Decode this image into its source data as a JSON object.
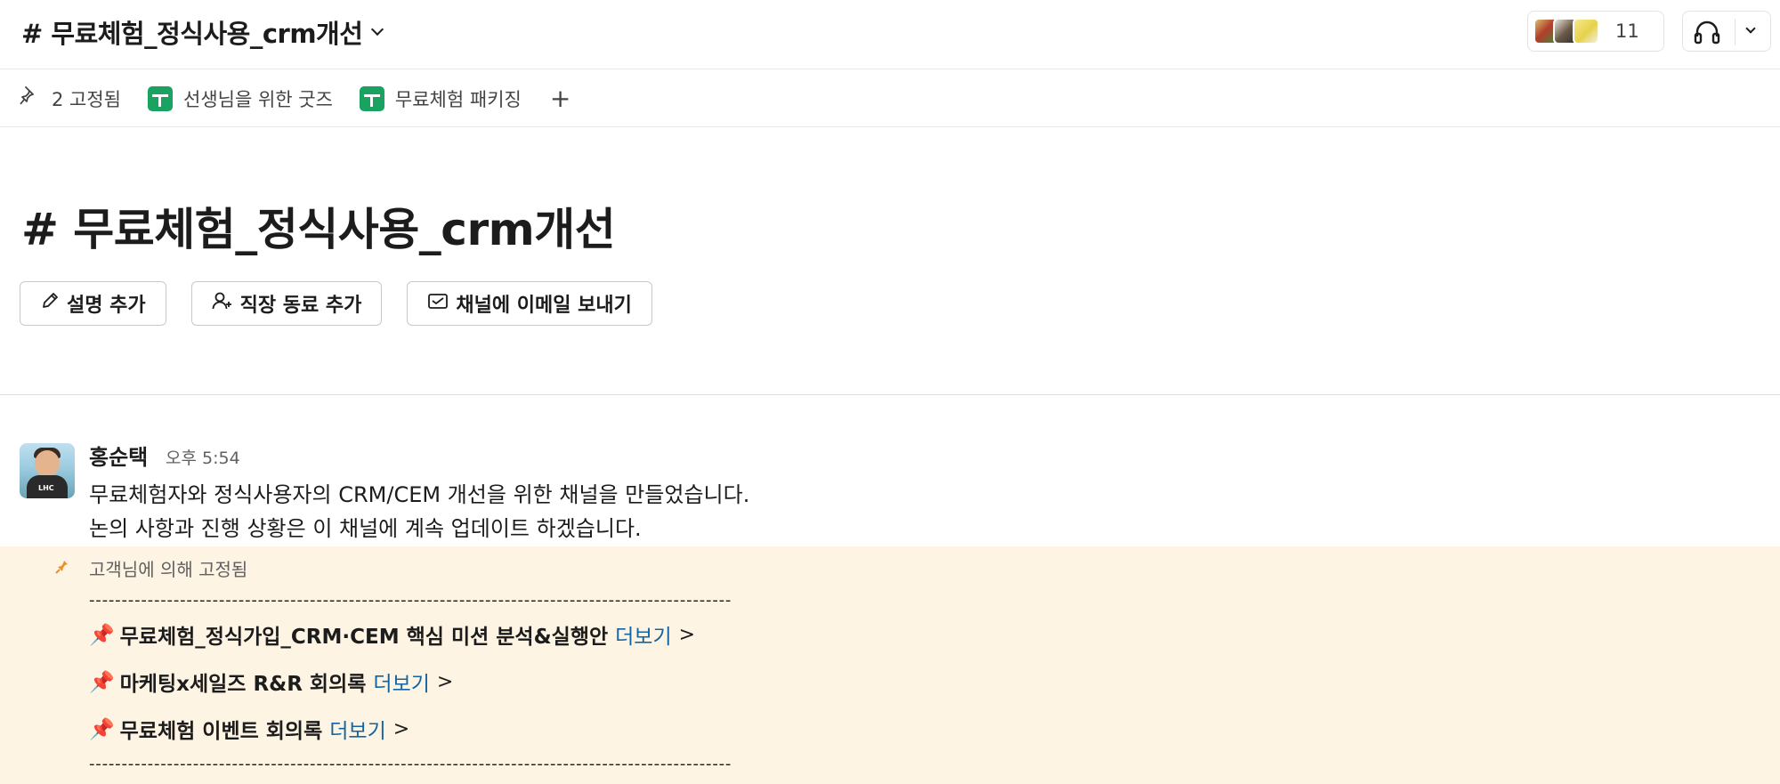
{
  "header": {
    "channel_title": "# 무료체험_정식사용_crm개선",
    "member_count": "11"
  },
  "bookmarks": {
    "pinned_label": "2 고정됨",
    "items": [
      {
        "label": "선생님을 위한 굿즈",
        "icon": "google-sheets-icon"
      },
      {
        "label": "무료체험 패키징",
        "icon": "google-sheets-icon"
      }
    ],
    "add_label": "+"
  },
  "intro": {
    "title": "# 무료체험_정식사용_crm개선",
    "buttons": {
      "add_description": "설명 추가",
      "add_coworkers": "직장 동료 추가",
      "send_email": "채널에 이메일 보내기"
    }
  },
  "message": {
    "author": "홍순택",
    "time": "오후 5:54",
    "avatar_badge": "LHC",
    "lines": [
      "무료체험자와 정식사용자의 CRM/CEM 개선을 위한 채널을 만들었습니다.",
      "논의 사항과 진행 상황은 이 채널에 계속 업데이트 하겠습니다."
    ]
  },
  "pinned": {
    "pinned_by": "고객님에 의해 고정됨",
    "dashes": "---------------------------------------------------------------------------------------------------",
    "items": [
      {
        "emoji": "📌",
        "title": "무료체험_정식가입_CRM·CEM 핵심 미션 분석&실행안",
        "more": "더보기",
        "arrow": ">"
      },
      {
        "emoji": "📌",
        "title": "마케팅x세일즈 R&R 회의록",
        "more": "더보기",
        "arrow": ">"
      },
      {
        "emoji": "📌",
        "title": "무료체험 이벤트 회의록",
        "more": "더보기",
        "arrow": ">"
      }
    ]
  },
  "colors": {
    "pinned_background": "#fdf4e3",
    "link": "#1264a3",
    "sheets_green": "#1aa260"
  }
}
